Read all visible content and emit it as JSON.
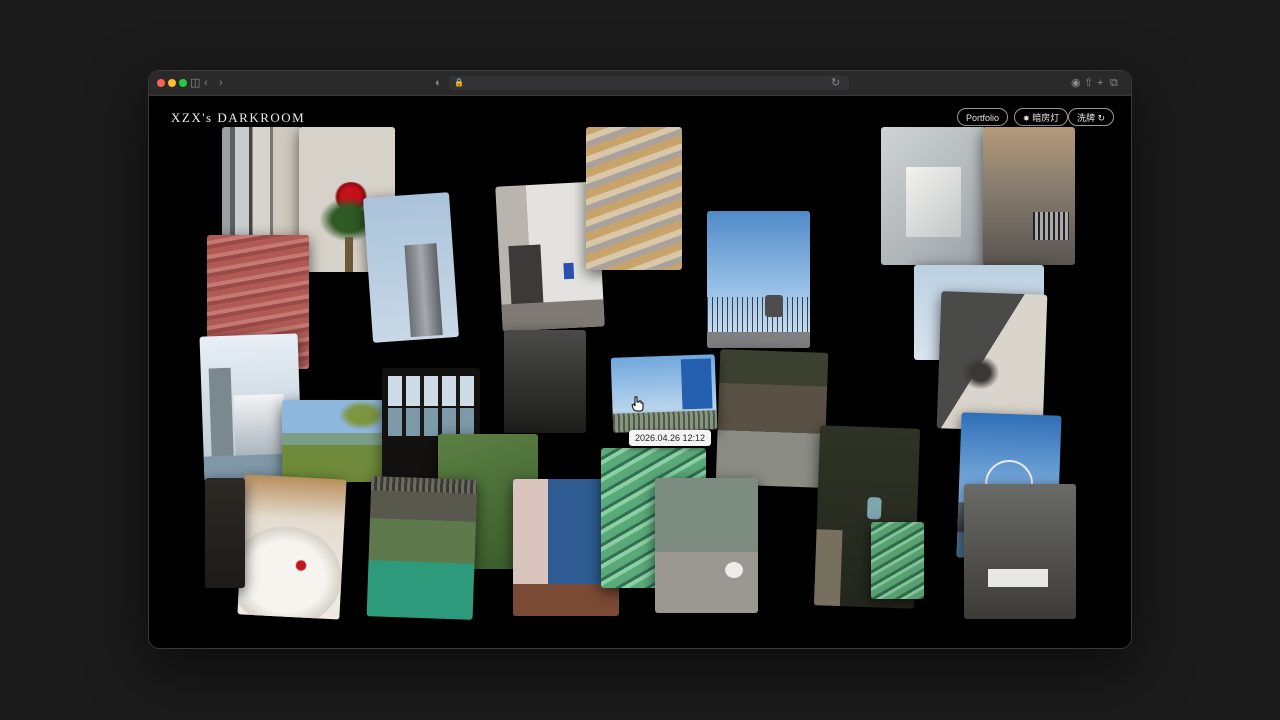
{
  "site": {
    "brand": "XZX's DARKROOM"
  },
  "nav": {
    "portfolio_label": "Portfolio",
    "safelight_label": "暗房灯",
    "shuffle_label": "洗牌"
  },
  "hover": {
    "timestamp": "2026.04.26 12:12"
  },
  "icons": {
    "safelight": "sun-icon",
    "shuffle": "refresh-icon",
    "cursor": "hand-cursor-icon"
  },
  "colors": {
    "page_background": "#000000",
    "desktop_background": "#1b1b1b",
    "text": "#e6e6e6"
  }
}
